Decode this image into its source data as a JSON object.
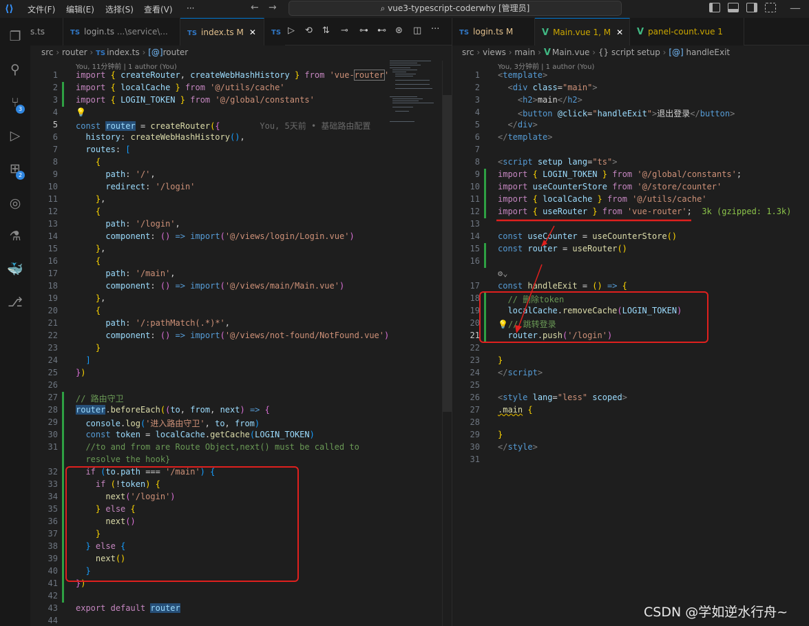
{
  "titlebar": {
    "menus": [
      "文件(F)",
      "编辑(E)",
      "选择(S)",
      "查看(V)",
      "···"
    ],
    "search": "vue3-typescript-coderwhy [管理员]"
  },
  "activity": {
    "scm_badge": "3",
    "ext_badge": "2"
  },
  "left": {
    "tabs": [
      {
        "icon": "",
        "label": "s.ts",
        "mod": ""
      },
      {
        "icon": "TS",
        "label": "login.ts",
        "path": "...\\service\\...",
        "mod": ""
      },
      {
        "icon": "TS",
        "label": "index.ts",
        "mod": "M"
      },
      {
        "icon": "TS",
        "label": ""
      }
    ],
    "breadcrumb": [
      "src",
      "router",
      "TS",
      "index.ts",
      "[@]",
      "router"
    ],
    "codelens": "You, 11分钟前 | 1 author (You)",
    "inline_blame": "You, 5天前 • 基础路由配置"
  },
  "right": {
    "tabs": [
      {
        "icon": "TS",
        "label": "login.ts",
        "mod": "M"
      },
      {
        "icon": "V",
        "label": "Main.vue",
        "mod": "1, M"
      },
      {
        "icon": "V",
        "label": "panel-count.vue",
        "mod": "1"
      }
    ],
    "breadcrumb": [
      "src",
      "views",
      "main",
      "Main.vue",
      "{}",
      "script setup",
      "[@]",
      "handleExit"
    ],
    "codelens": "You, 3分钟前 | 1 author (You)",
    "import_size": "3k (gzipped: 1.3k)"
  },
  "watermark": "CSDN @学如逆水行舟~"
}
